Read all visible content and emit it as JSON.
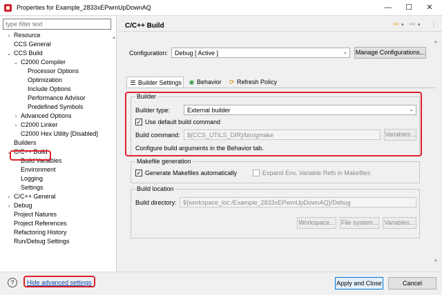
{
  "window": {
    "title": "Properties for Example_2833xEPwmUpDownAQ",
    "minimize": "—",
    "maximize": "☐",
    "close": "✕"
  },
  "filter": {
    "placeholder": "type filter text"
  },
  "tree": [
    {
      "label": "Resource",
      "toggle": "›"
    },
    {
      "label": "CCS General",
      "toggle": ""
    },
    {
      "label": "CCS Build",
      "toggle": "⌄"
    },
    {
      "label": "C2000 Compiler",
      "toggle": "⌄"
    },
    {
      "label": "Processor Options",
      "toggle": ""
    },
    {
      "label": "Optimization",
      "toggle": ""
    },
    {
      "label": "Include Options",
      "toggle": ""
    },
    {
      "label": "Performance Advisor",
      "toggle": ""
    },
    {
      "label": "Predefined Symbols",
      "toggle": ""
    },
    {
      "label": "Advanced Options",
      "toggle": "›"
    },
    {
      "label": "C2000 Linker",
      "toggle": "›"
    },
    {
      "label": "C2000 Hex Utility  [Disabled]",
      "toggle": ""
    },
    {
      "label": "Builders",
      "toggle": ""
    },
    {
      "label": "C/C++ Build",
      "toggle": "⌄"
    },
    {
      "label": "Build Variables",
      "toggle": ""
    },
    {
      "label": "Environment",
      "toggle": ""
    },
    {
      "label": "Logging",
      "toggle": ""
    },
    {
      "label": "Settings",
      "toggle": ""
    },
    {
      "label": "C/C++ General",
      "toggle": "›"
    },
    {
      "label": "Debug",
      "toggle": "›"
    },
    {
      "label": "Project Natures",
      "toggle": ""
    },
    {
      "label": "Project References",
      "toggle": ""
    },
    {
      "label": "Refactoring History",
      "toggle": ""
    },
    {
      "label": "Run/Debug Settings",
      "toggle": ""
    }
  ],
  "page": {
    "title": "C/C++ Build",
    "nav_back": "⇦",
    "nav_forward": "⇨",
    "menu": "⋮",
    "configuration_label": "Configuration:",
    "configuration_value": "Debug  [ Active ]",
    "manage_configurations": "Manage Configurations..."
  },
  "tabs": [
    {
      "label": "Builder Settings",
      "icon": "☰"
    },
    {
      "label": "Behavior",
      "icon": "◉"
    },
    {
      "label": "Refresh Policy",
      "icon": "⟳"
    }
  ],
  "builder": {
    "group_title": "Builder",
    "type_label": "Builder type:",
    "type_value": "External builder",
    "use_default_label": "Use default build command",
    "use_default_checked": "✓",
    "command_label": "Build command:",
    "command_value": "${CCS_UTILS_DIR}/bin/gmake",
    "variables_button": "Variables...",
    "note": "Configure build arguments in the Behavior tab."
  },
  "makefile": {
    "group_title": "Makefile generation",
    "generate_label": "Generate Makefiles automatically",
    "generate_checked": "✓",
    "expand_label": "Expand Env. Variable Refs in Makefiles"
  },
  "location": {
    "group_title": "Build location",
    "directory_label": "Build directory:",
    "directory_value": "${workspace_loc:/Example_2833xEPwmUpDownAQ}/Debug",
    "workspace_button": "Workspace...",
    "filesystem_button": "File system...",
    "variables_button": "Variables..."
  },
  "footer": {
    "help": "?",
    "advanced_link": "Hide advanced settings",
    "apply_close": "Apply and Close",
    "cancel": "Cancel"
  },
  "colors": {
    "highlight": "#e0202a",
    "accent": "#0078d7",
    "link": "#0645ad"
  }
}
